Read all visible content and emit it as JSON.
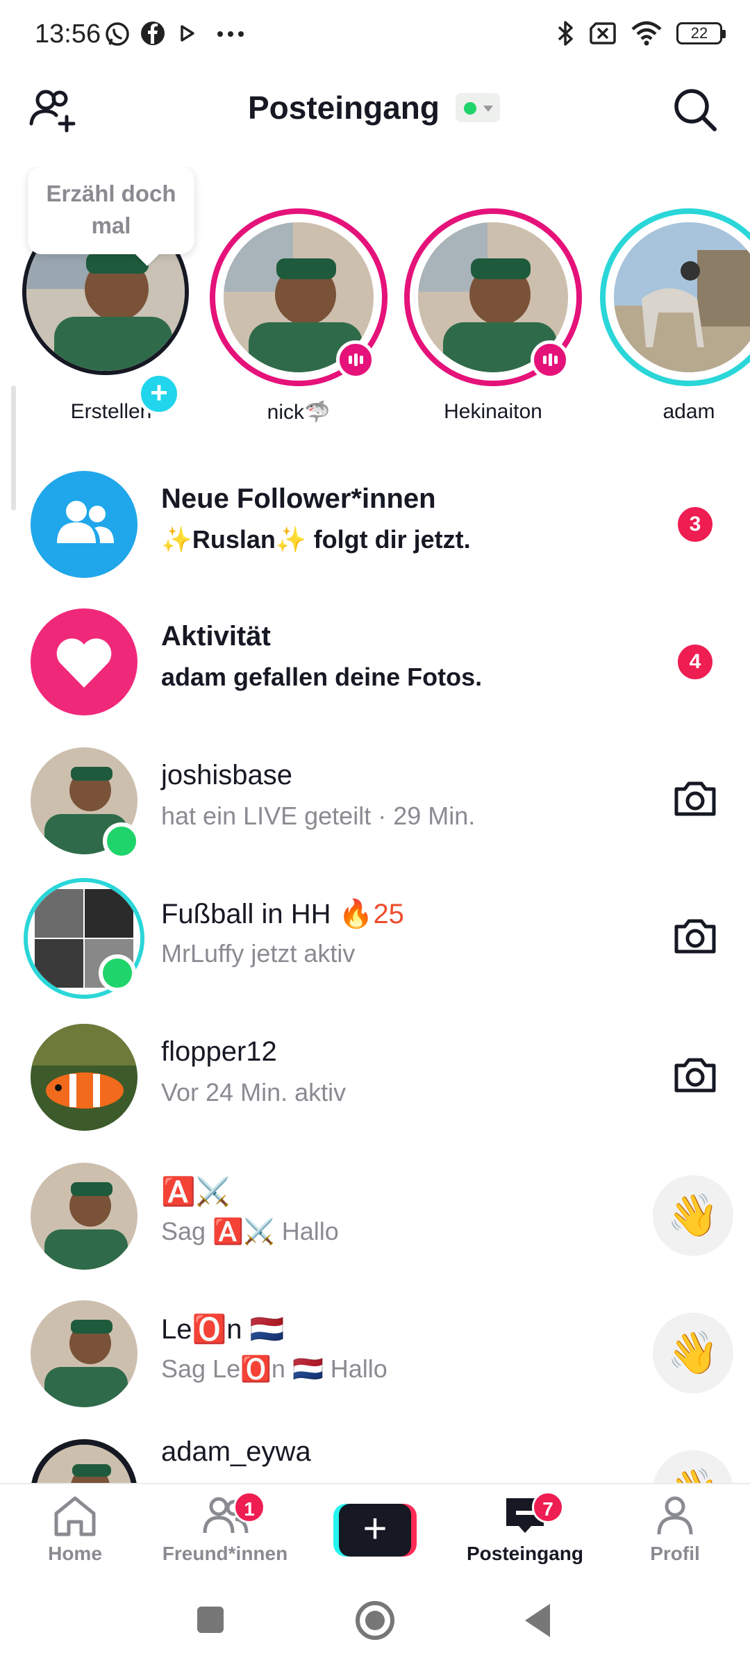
{
  "status_bar": {
    "time": "13:56",
    "battery": "22",
    "left_icons": [
      "whatsapp-icon",
      "facebook-icon",
      "play-icon",
      "more-dots-icon"
    ],
    "right_icons": [
      "bluetooth-icon",
      "sim-off-icon",
      "wifi-icon",
      "battery-icon"
    ]
  },
  "header": {
    "title": "Posteingang",
    "status_color": "#1fd46a"
  },
  "stories": {
    "tooltip": "Erzähl doch mal",
    "items": [
      {
        "name": "Erstellen"
      },
      {
        "name": "nick🦈"
      },
      {
        "name": "Hekinaiton"
      },
      {
        "name": "adam"
      }
    ]
  },
  "inbox": [
    {
      "title": "Neue Follower*innen",
      "subtitle": "✨Ruslan✨ folgt dir jetzt.",
      "badge": "3"
    },
    {
      "title": "Aktivität",
      "subtitle": "adam gefallen deine Fotos.",
      "badge": "4"
    },
    {
      "title": "joshisbase",
      "subtitle": "hat ein LIVE geteilt · 29 Min."
    },
    {
      "title": "Fußball in HH 🔥",
      "streak": "25",
      "subtitle": "MrLuffy jetzt aktiv"
    },
    {
      "title": "flopper12",
      "subtitle": "Vor 24 Min. aktiv"
    },
    {
      "title": "🅰️⚔️",
      "subtitle": "Sag 🅰️⚔️ Hallo"
    },
    {
      "title": "Le🅾️n 🇳🇱",
      "subtitle": "Sag Le🅾️n 🇳🇱 Hallo"
    },
    {
      "title": "adam_eywa"
    }
  ],
  "wave_emoji": "👋",
  "bottom_nav": {
    "home": "Home",
    "friends": "Freund*innen",
    "friends_badge": "1",
    "create": "+",
    "inbox": "Posteingang",
    "inbox_badge": "7",
    "profile": "Profil"
  },
  "colors": {
    "accent_pink": "#fe2c55",
    "badge_red": "#ee1d52",
    "followers_blue": "#20a6ea",
    "activity_pink": "#f0287a",
    "online_green": "#1fd46a",
    "story_ring_pink": "#e5127a",
    "story_ring_cyan": "#2ad6d8"
  }
}
